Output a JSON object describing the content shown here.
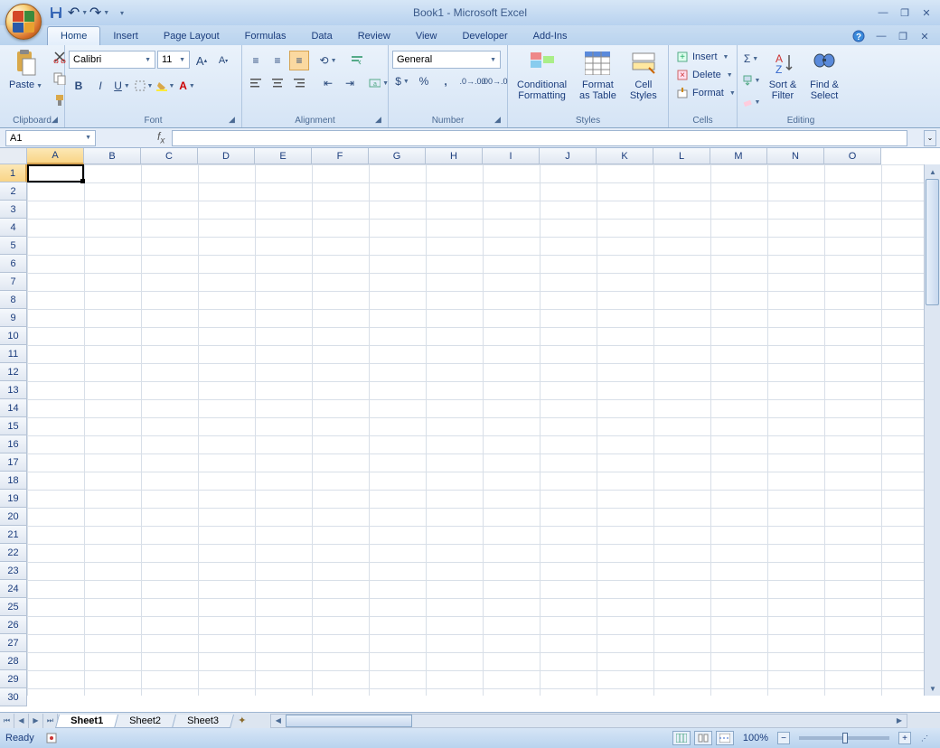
{
  "app_title": "Book1 - Microsoft Excel",
  "qat": {
    "save": "save",
    "undo": "undo",
    "redo": "redo"
  },
  "tabs": [
    "Home",
    "Insert",
    "Page Layout",
    "Formulas",
    "Data",
    "Review",
    "View",
    "Developer",
    "Add-Ins"
  ],
  "active_tab": "Home",
  "ribbon": {
    "clipboard": {
      "label": "Clipboard",
      "paste": "Paste"
    },
    "font": {
      "label": "Font",
      "name": "Calibri",
      "size": "11"
    },
    "alignment": {
      "label": "Alignment"
    },
    "number": {
      "label": "Number",
      "format": "General"
    },
    "styles": {
      "label": "Styles",
      "conditional": "Conditional\nFormatting",
      "table": "Format\nas Table",
      "cell": "Cell\nStyles"
    },
    "cells": {
      "label": "Cells",
      "insert": "Insert",
      "delete": "Delete",
      "format": "Format"
    },
    "editing": {
      "label": "Editing",
      "sort": "Sort &\nFilter",
      "find": "Find &\nSelect"
    }
  },
  "name_box": "A1",
  "columns": [
    "A",
    "B",
    "C",
    "D",
    "E",
    "F",
    "G",
    "H",
    "I",
    "J",
    "K",
    "L",
    "M",
    "N",
    "O"
  ],
  "rows": 30,
  "selected_cell": {
    "col": 0,
    "row": 0
  },
  "sheets": [
    "Sheet1",
    "Sheet2",
    "Sheet3"
  ],
  "active_sheet": "Sheet1",
  "status_text": "Ready",
  "zoom": "100%"
}
